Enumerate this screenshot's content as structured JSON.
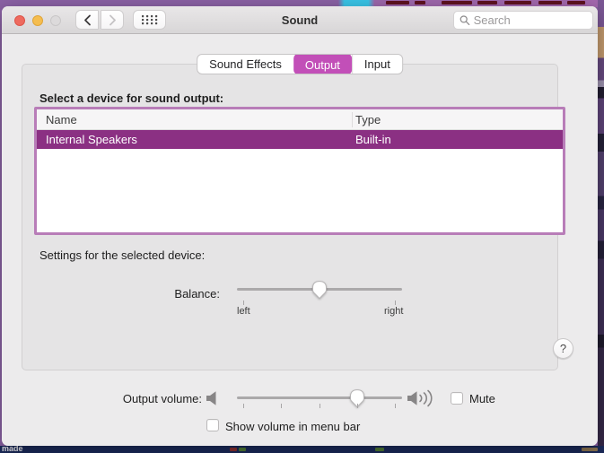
{
  "desktop": {
    "bottom_left_text": "made"
  },
  "titlebar": {
    "title": "Sound",
    "search": {
      "placeholder": "Search"
    }
  },
  "tabs": [
    {
      "label": "Sound Effects",
      "selected": false
    },
    {
      "label": "Output",
      "selected": true
    },
    {
      "label": "Input",
      "selected": false
    }
  ],
  "output_pane": {
    "select_device_label": "Select a device for sound output:",
    "table": {
      "columns": [
        "Name",
        "Type"
      ],
      "rows": [
        {
          "name": "Internal Speakers",
          "type": "Built-in",
          "selected": true
        }
      ]
    },
    "settings_label": "Settings for the selected device:",
    "balance": {
      "label": "Balance:",
      "min_label": "left",
      "max_label": "right",
      "value_percent": 50
    }
  },
  "help_button_label": "?",
  "volume_row": {
    "label": "Output volume:",
    "value_percent": 73,
    "mute_label": "Mute",
    "mute_checked": false
  },
  "menu_bar_row": {
    "label": "Show volume in menu bar",
    "checked": false
  },
  "colors": {
    "accent_selected_tab": "#c24fb8",
    "selected_row": "#8b3083",
    "focus_ring": "#b87db8"
  }
}
